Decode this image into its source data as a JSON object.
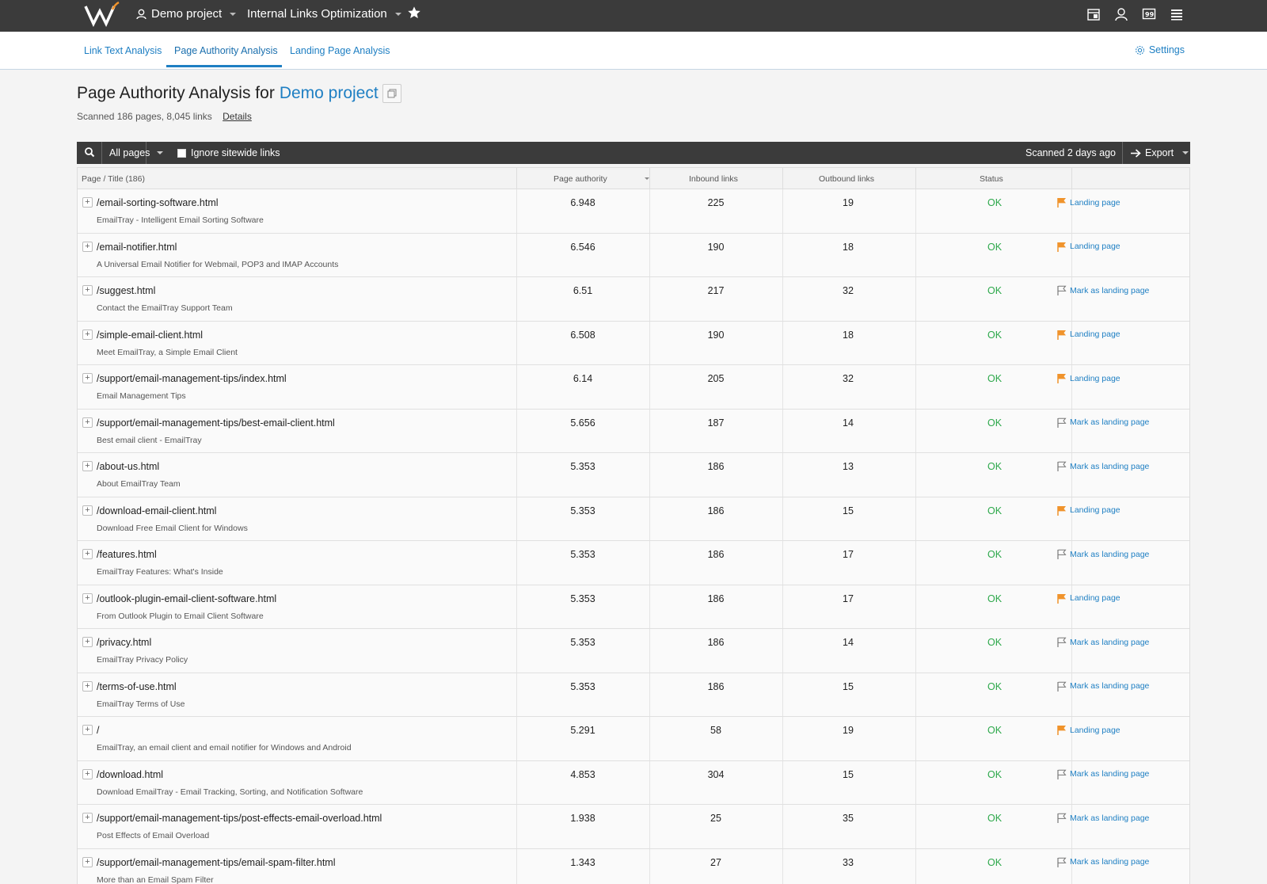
{
  "topbar": {
    "project": "Demo project",
    "tool": "Internal Links Optimization"
  },
  "subnav": {
    "tabs": [
      "Link Text Analysis",
      "Page Authority Analysis",
      "Landing Page Analysis"
    ],
    "active_tab": "Page Authority Analysis",
    "settings": "Settings"
  },
  "heading": {
    "prefix": "Page Authority Analysis for",
    "project": "Demo project",
    "scanned": "Scanned 186 pages, 8,045 links",
    "details": "Details"
  },
  "toolbar": {
    "filter": "All pages",
    "ignore_sitewide": "Ignore sitewide links",
    "ignore_checked": false,
    "scanned_ago": "Scanned 2 days ago",
    "export": "Export"
  },
  "table": {
    "columns": [
      "Page / Title (186)",
      "Page authority",
      "Inbound links",
      "Outbound links",
      "Status"
    ],
    "rows": [
      {
        "url": "/email-sorting-software.html",
        "title": "EmailTray - Intelligent Email Sorting Software",
        "authority": "6.948",
        "inbound": "225",
        "outbound": "19",
        "status": "OK",
        "landing": true,
        "action": "Landing page"
      },
      {
        "url": "/email-notifier.html",
        "title": "A Universal Email Notifier for Webmail, POP3 and IMAP Accounts",
        "authority": "6.546",
        "inbound": "190",
        "outbound": "18",
        "status": "OK",
        "landing": true,
        "action": "Landing page"
      },
      {
        "url": "/suggest.html",
        "title": "Contact the EmailTray Support Team",
        "authority": "6.51",
        "inbound": "217",
        "outbound": "32",
        "status": "OK",
        "landing": false,
        "action": "Mark as landing page"
      },
      {
        "url": "/simple-email-client.html",
        "title": "Meet EmailTray, a Simple Email Client",
        "authority": "6.508",
        "inbound": "190",
        "outbound": "18",
        "status": "OK",
        "landing": true,
        "action": "Landing page"
      },
      {
        "url": "/support/email-management-tips/index.html",
        "title": "Email Management Tips",
        "authority": "6.14",
        "inbound": "205",
        "outbound": "32",
        "status": "OK",
        "landing": true,
        "action": "Landing page"
      },
      {
        "url": "/support/email-management-tips/best-email-client.html",
        "title": "Best email client - EmailTray",
        "authority": "5.656",
        "inbound": "187",
        "outbound": "14",
        "status": "OK",
        "landing": false,
        "action": "Mark as landing page"
      },
      {
        "url": "/about-us.html",
        "title": "About EmailTray Team",
        "authority": "5.353",
        "inbound": "186",
        "outbound": "13",
        "status": "OK",
        "landing": false,
        "action": "Mark as landing page"
      },
      {
        "url": "/download-email-client.html",
        "title": "Download Free Email Client for Windows",
        "authority": "5.353",
        "inbound": "186",
        "outbound": "15",
        "status": "OK",
        "landing": true,
        "action": "Landing page"
      },
      {
        "url": "/features.html",
        "title": "EmailTray Features: What's Inside",
        "authority": "5.353",
        "inbound": "186",
        "outbound": "17",
        "status": "OK",
        "landing": false,
        "action": "Mark as landing page"
      },
      {
        "url": "/outlook-plugin-email-client-software.html",
        "title": "From Outlook Plugin to Email Client Software",
        "authority": "5.353",
        "inbound": "186",
        "outbound": "17",
        "status": "OK",
        "landing": true,
        "action": "Landing page"
      },
      {
        "url": "/privacy.html",
        "title": "EmailTray Privacy Policy",
        "authority": "5.353",
        "inbound": "186",
        "outbound": "14",
        "status": "OK",
        "landing": false,
        "action": "Mark as landing page"
      },
      {
        "url": "/terms-of-use.html",
        "title": "EmailTray Terms of Use",
        "authority": "5.353",
        "inbound": "186",
        "outbound": "15",
        "status": "OK",
        "landing": false,
        "action": "Mark as landing page"
      },
      {
        "url": "/",
        "title": "EmailTray, an email client and email notifier for Windows and Android",
        "authority": "5.291",
        "inbound": "58",
        "outbound": "19",
        "status": "OK",
        "landing": true,
        "action": "Landing page"
      },
      {
        "url": "/download.html",
        "title": "Download EmailTray - Email Tracking, Sorting, and Notification Software",
        "authority": "4.853",
        "inbound": "304",
        "outbound": "15",
        "status": "OK",
        "landing": false,
        "action": "Mark as landing page"
      },
      {
        "url": "/support/email-management-tips/post-effects-email-overload.html",
        "title": "Post Effects of Email Overload",
        "authority": "1.938",
        "inbound": "25",
        "outbound": "35",
        "status": "OK",
        "landing": false,
        "action": "Mark as landing page"
      },
      {
        "url": "/support/email-management-tips/email-spam-filter.html",
        "title": "More than an Email Spam Filter",
        "authority": "1.343",
        "inbound": "27",
        "outbound": "33",
        "status": "OK",
        "landing": false,
        "action": "Mark as landing page"
      }
    ]
  },
  "colors": {
    "accent": "#1e7fc3",
    "topbar": "#3b3b3b",
    "ok": "#2ca84a",
    "flag": "#f0932b"
  },
  "icons": [
    "logo-icon",
    "user-icon",
    "star-icon",
    "calendar-icon",
    "profile-icon",
    "quote-icon",
    "menu-icon",
    "gear-icon",
    "search-icon",
    "copy-icon",
    "export-arrow-icon",
    "flag-icon"
  ]
}
